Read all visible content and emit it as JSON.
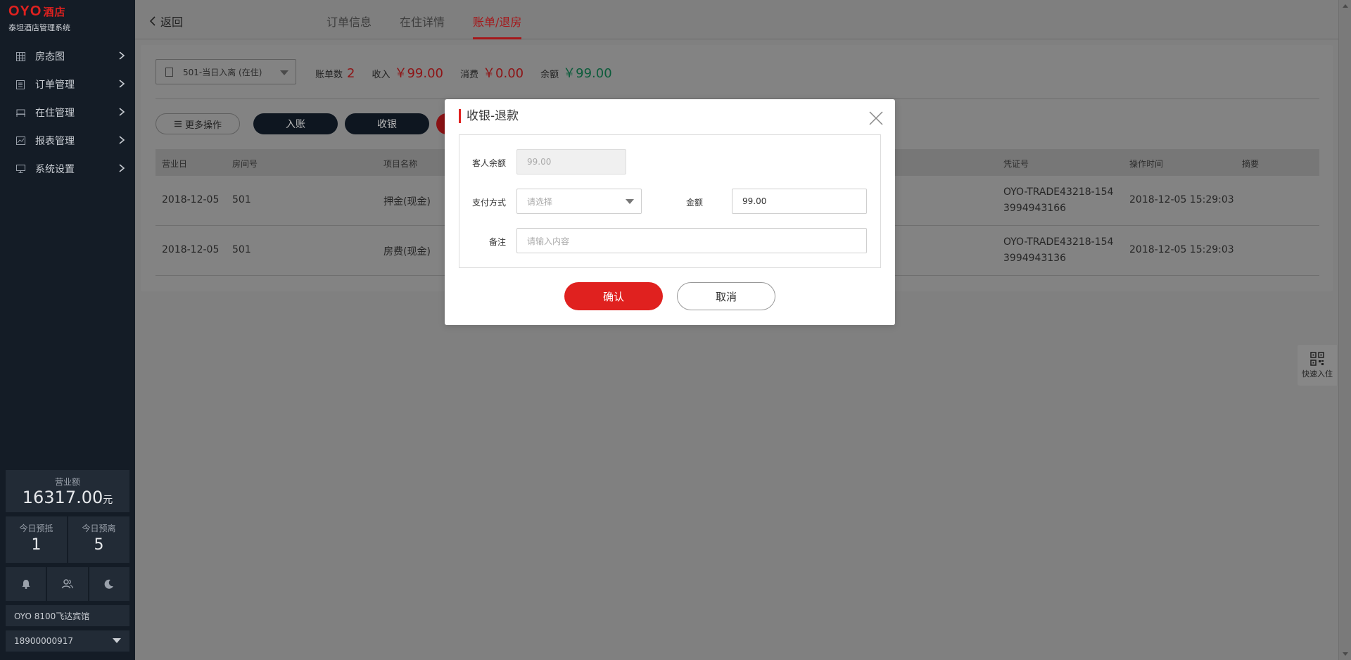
{
  "sidebar": {
    "brand": "OYO",
    "brand_cn": "酒店",
    "system_name": "泰坦酒店管理系统",
    "menu": [
      {
        "label": "房态图",
        "icon": "grid-icon"
      },
      {
        "label": "订单管理",
        "icon": "list-icon"
      },
      {
        "label": "在住管理",
        "icon": "bed-icon"
      },
      {
        "label": "报表管理",
        "icon": "chart-icon"
      },
      {
        "label": "系统设置",
        "icon": "monitor-icon"
      }
    ],
    "revenue_label": "营业额",
    "revenue_value": "16317.00",
    "revenue_unit": "元",
    "today_deposit_label": "今日预抵",
    "today_deposit_value": "1",
    "today_leave_label": "今日预离",
    "today_leave_value": "5",
    "quick_icons": [
      "bell-icon",
      "users-icon",
      "moon-icon"
    ],
    "hotel_name": "OYO 8100飞达宾馆",
    "phone": "18900000917"
  },
  "topbar": {
    "back_label": "返回",
    "tabs": [
      "订单信息",
      "在住详情",
      "账单/退房"
    ],
    "active_tab": "账单/退房"
  },
  "panel": {
    "room_select": "501-当日入离 (在住)",
    "summary": {
      "bill_count_label": "账单数",
      "bill_count": "2",
      "income_label": "收入",
      "income": "￥99.00",
      "consume_label": "消费",
      "consume": "￥0.00",
      "balance_label": "余额",
      "balance": "￥99.00"
    },
    "more_ops_label": "更多操作",
    "btn_checkin": "入账",
    "btn_cashier": "收银",
    "table": {
      "headers": [
        "营业日",
        "房间号",
        "项目名称",
        "凭证号",
        "操作时间",
        "摘要"
      ],
      "rows": [
        {
          "date": "2018-12-05",
          "room": "501",
          "item": "押金(现金)",
          "voucher_1": "OYO-TRADE43218-154",
          "voucher_2": "3994943166",
          "time": "2018-12-05 15:29:03"
        },
        {
          "date": "2018-12-05",
          "room": "501",
          "item": "房费(现金)",
          "voucher_1": "OYO-TRADE43218-154",
          "voucher_2": "3994943136",
          "time": "2018-12-05 15:29:03"
        }
      ]
    }
  },
  "quick_checkin_label": "快速入住",
  "modal": {
    "title": "收银-退款",
    "guest_balance_label": "客人余额",
    "guest_balance_value": "99.00",
    "pay_method_label": "支付方式",
    "pay_method_placeholder": "请选择",
    "amount_label": "金额",
    "amount_value": "99.00",
    "remark_label": "备注",
    "remark_placeholder": "请输入内容",
    "confirm_label": "确认",
    "cancel_label": "取消"
  },
  "colors": {
    "accent_red": "#e0211f",
    "sidebar_bg": "#141c26",
    "balance_green": "#0c5c3b"
  }
}
